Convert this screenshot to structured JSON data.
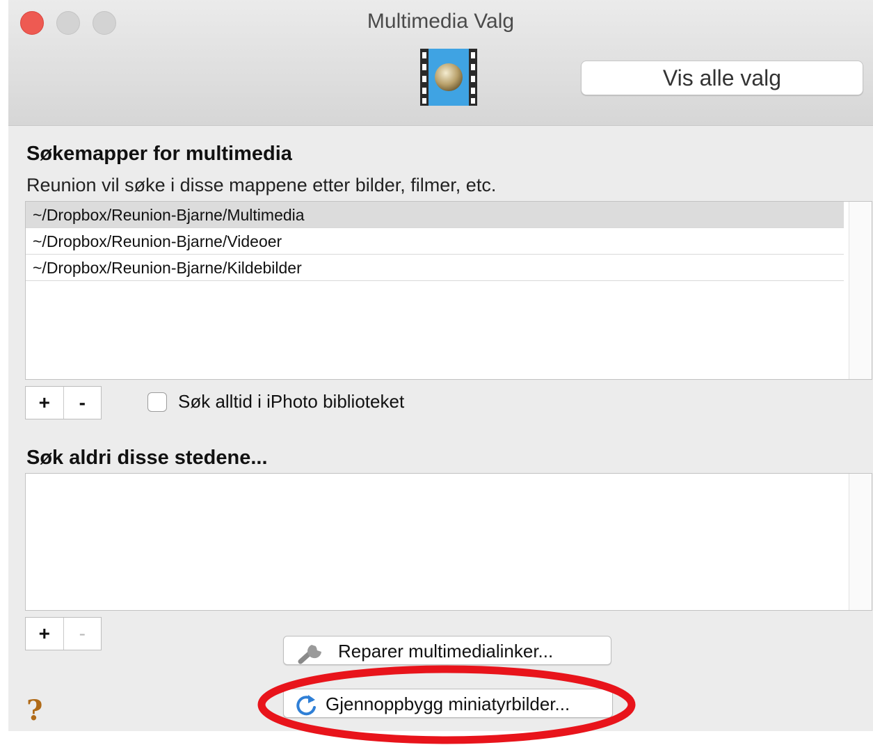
{
  "window": {
    "title": "Multimedia Valg",
    "show_all_label": "Vis alle valg",
    "toolbar_icon": "film-strip-icon"
  },
  "search_folders": {
    "heading": "Søkemapper for multimedia",
    "description": "Reunion vil søke i disse mappene etter bilder, filmer, etc.",
    "items": [
      "~/Dropbox/Reunion-Bjarne/Multimedia",
      "~/Dropbox/Reunion-Bjarne/Videoer",
      "~/Dropbox/Reunion-Bjarne/Kildebilder"
    ],
    "selected_index": 0,
    "add_label": "+",
    "remove_label": "-",
    "iphoto_checkbox_label": "Søk alltid i iPhoto biblioteket",
    "iphoto_checked": false
  },
  "never_search": {
    "heading": "Søk aldri disse stedene...",
    "items": [],
    "add_label": "+",
    "remove_label": "-"
  },
  "actions": {
    "repair_label": "Reparer multimedialinker...",
    "repair_icon": "wrench-icon",
    "rebuild_label": "Gjennoppbygg miniatyrbilder...",
    "rebuild_icon": "refresh-icon"
  },
  "help_label": "?",
  "colors": {
    "highlight_ring": "#e8141b",
    "close_button": "#ee5a52",
    "refresh_icon": "#2f7fd6"
  }
}
